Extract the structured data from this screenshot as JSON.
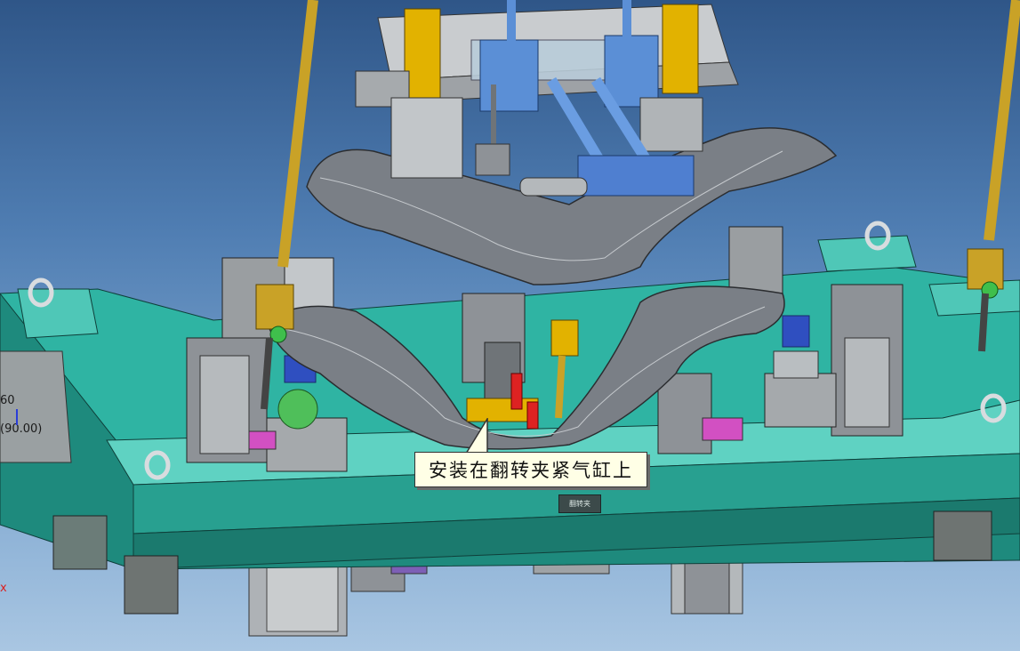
{
  "window": {
    "title": ""
  },
  "callout": {
    "text": "安装在翻转夹紧气缸上"
  },
  "nameplate": {
    "text": "翻转夹"
  },
  "triad": {
    "top": "60",
    "value": "(90.00)",
    "axis_x": "x"
  },
  "colors": {
    "background_top": "#2f5688",
    "background_bottom": "#a9c6e2",
    "base_frame": "#2fb4a3",
    "base_frame_dark": "#1e8a7d",
    "base_frame_light": "#5fd2c2",
    "lifting_rod": "#c9a227",
    "cylinder_blue": "#5b8fd6",
    "bracket_yellow": "#e2b200",
    "part_mesh": "#7a7f86",
    "machine_gray": "#8e9297",
    "callout_bg": "#ffffe6"
  },
  "icons": {
    "lifting_eye": "lifting-eye-icon",
    "triad": "coordinate-triad-icon"
  }
}
